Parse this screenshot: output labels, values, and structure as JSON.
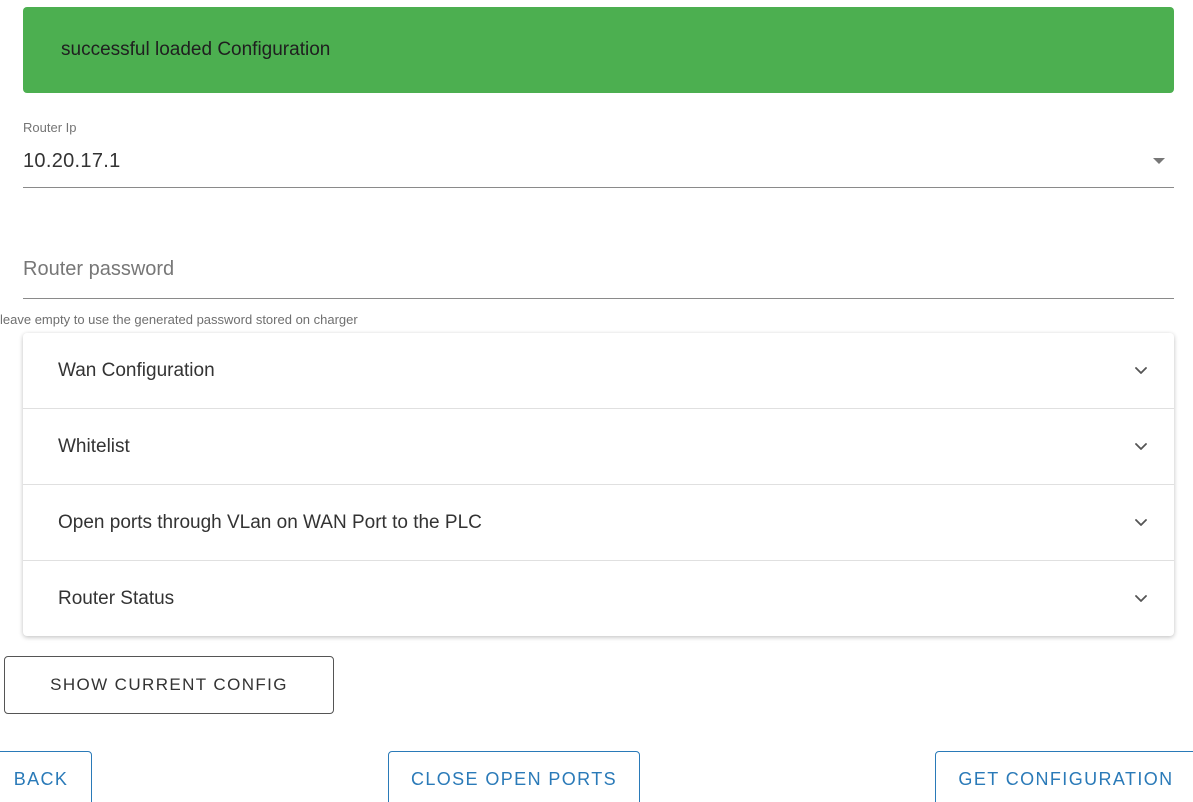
{
  "alert": {
    "message": "successful loaded Configuration",
    "color": "#4caf50"
  },
  "router_ip": {
    "label": "Router Ip",
    "value": "10.20.17.1"
  },
  "router_password": {
    "placeholder": "Router password",
    "value": "",
    "helper": "leave empty to use the generated password stored on charger"
  },
  "accordion": {
    "items": [
      {
        "label": "Wan Configuration",
        "icon": "chevron-down-icon"
      },
      {
        "label": "Whitelist",
        "icon": "chevron-down-icon"
      },
      {
        "label": "Open ports through VLan on WAN Port to the PLC",
        "icon": "chevron-down-icon"
      },
      {
        "label": "Router Status",
        "icon": "chevron-down-icon"
      }
    ]
  },
  "buttons": {
    "show_current_config": "SHOW CURRENT CONFIG",
    "back": "BACK",
    "close_open_ports": "CLOSE OPEN PORTS",
    "get_configuration": "GET CONFIGURATION"
  },
  "colors": {
    "primary": "#2a7ab8",
    "success": "#4caf50"
  }
}
